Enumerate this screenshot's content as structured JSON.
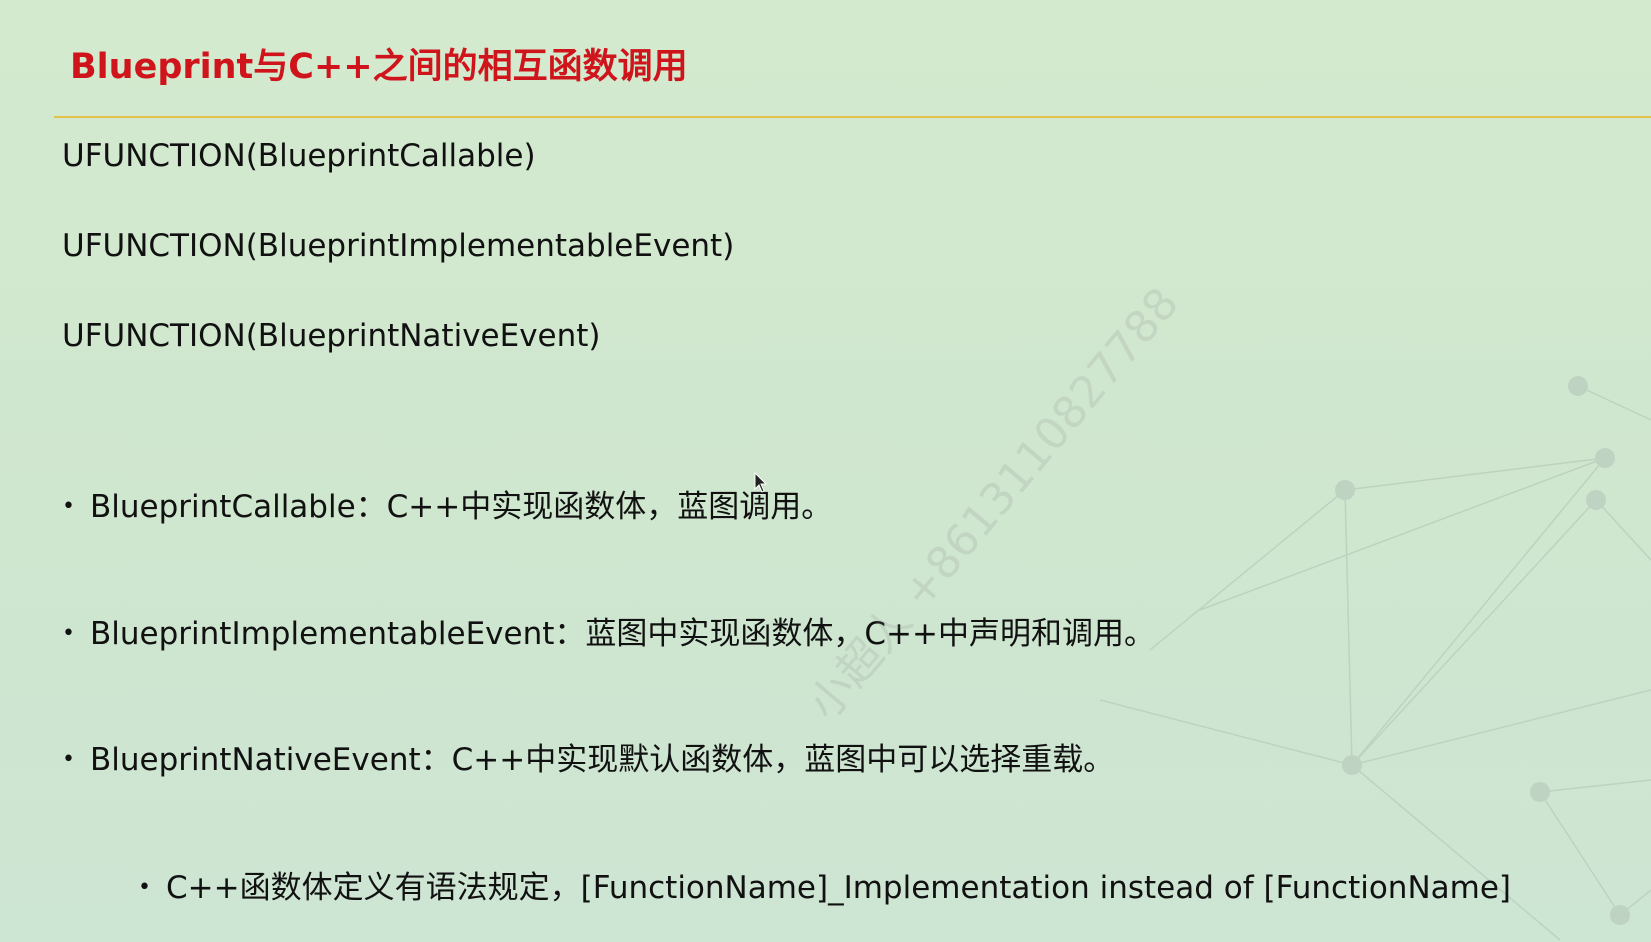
{
  "slide": {
    "title": "Blueprint与C++之间的相互函数调用",
    "code_lines": [
      "UFUNCTION(BlueprintCallable)",
      "UFUNCTION(BlueprintImplementableEvent)",
      "UFUNCTION(BlueprintNativeEvent)"
    ],
    "bullets": [
      "BlueprintCallable：C++中实现函数体，蓝图调用。",
      "BlueprintImplementableEvent：蓝图中实现函数体，C++中声明和调用。",
      "BlueprintNativeEvent：C++中实现默认函数体，蓝图中可以选择重载。"
    ],
    "sub_bullet": "C++函数体定义有语法规定，[FunctionName]_Implementation instead of [FunctionName]",
    "bullet_symbol": "•",
    "watermark": "小超人 +8613110827788"
  },
  "colors": {
    "background": "#d2e8d1",
    "title": "#d0141b",
    "rule": "#e1c14a",
    "text": "#111111"
  },
  "icons": {
    "cursor": "mouse-pointer-icon"
  }
}
